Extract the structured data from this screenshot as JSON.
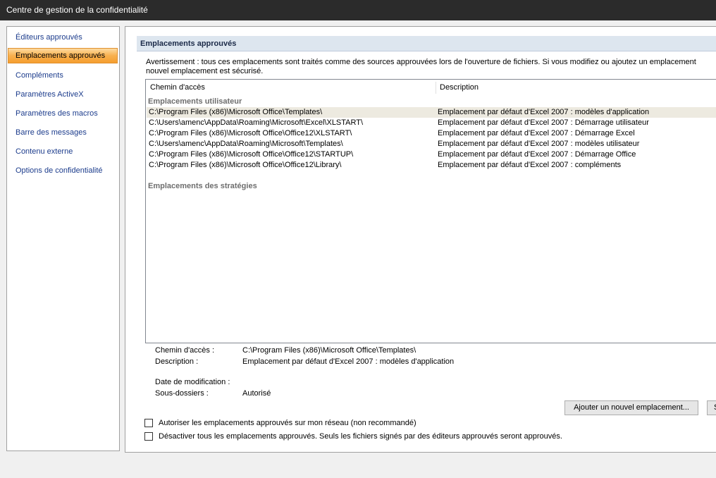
{
  "window": {
    "title": "Centre de gestion de la confidentialité"
  },
  "sidebar": {
    "items": [
      {
        "label": "Éditeurs approuvés",
        "active": false
      },
      {
        "label": "Emplacements approuvés",
        "active": true
      },
      {
        "label": "Compléments",
        "active": false
      },
      {
        "label": "Paramètres ActiveX",
        "active": false
      },
      {
        "label": "Paramètres des macros",
        "active": false
      },
      {
        "label": "Barre des messages",
        "active": false
      },
      {
        "label": "Contenu externe",
        "active": false
      },
      {
        "label": "Options de confidentialité",
        "active": false
      }
    ]
  },
  "main": {
    "header": "Emplacements approuvés",
    "warning": "Avertissement : tous ces emplacements sont traités comme des sources approuvées lors de l'ouverture de fichiers. Si vous modifiez ou ajoutez un emplacement\nnouvel emplacement est sécurisé.",
    "columns": {
      "path": "Chemin d'accès",
      "description": "Description"
    },
    "groups": {
      "user": "Emplacements utilisateur",
      "policy": "Emplacements des stratégies"
    },
    "rows": [
      {
        "path": "C:\\Program Files (x86)\\Microsoft Office\\Templates\\",
        "description": "Emplacement par défaut d'Excel 2007 : modèles d'application",
        "selected": true
      },
      {
        "path": "C:\\Users\\amenc\\AppData\\Roaming\\Microsoft\\Excel\\XLSTART\\",
        "description": "Emplacement par défaut d'Excel 2007 : Démarrage utilisateur",
        "selected": false
      },
      {
        "path": "C:\\Program Files (x86)\\Microsoft Office\\Office12\\XLSTART\\",
        "description": "Emplacement par défaut d'Excel 2007 : Démarrage Excel",
        "selected": false
      },
      {
        "path": "C:\\Users\\amenc\\AppData\\Roaming\\Microsoft\\Templates\\",
        "description": "Emplacement par défaut d'Excel 2007 : modèles utilisateur",
        "selected": false
      },
      {
        "path": "C:\\Program Files (x86)\\Microsoft Office\\Office12\\STARTUP\\",
        "description": "Emplacement par défaut d'Excel 2007 : Démarrage Office",
        "selected": false
      },
      {
        "path": "C:\\Program Files (x86)\\Microsoft Office\\Office12\\Library\\",
        "description": "Emplacement par défaut d'Excel 2007 : compléments",
        "selected": false
      }
    ],
    "details": {
      "path_label": "Chemin d'accès :",
      "path_value": "C:\\Program Files (x86)\\Microsoft Office\\Templates\\",
      "description_label": "Description :",
      "description_value": "Emplacement par défaut d'Excel 2007 : modèles d'application",
      "modified_label": "Date de modification :",
      "modified_value": "",
      "subfolders_label": "Sous-dossiers :",
      "subfolders_value": "Autorisé"
    },
    "buttons": {
      "add": "Ajouter un nouvel emplacement...",
      "next_partial": "S"
    },
    "checkboxes": {
      "network": {
        "label": "Autoriser les emplacements approuvés sur mon réseau (non recommandé)",
        "checked": false
      },
      "disable": {
        "label": "Désactiver tous les emplacements approuvés. Seuls les fichiers signés par des éditeurs approuvés seront approuvés.",
        "checked": false
      }
    }
  }
}
